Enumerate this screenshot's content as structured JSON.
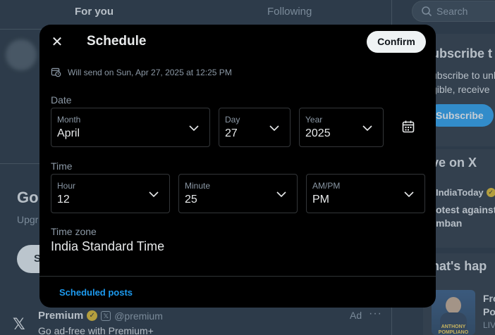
{
  "background": {
    "tabs": {
      "for_you": "For you",
      "following": "Following"
    },
    "search_placeholder": "Search",
    "promo": {
      "heading": "Go",
      "sub": "Upgr",
      "button": "S"
    },
    "ad": {
      "name": "Premium",
      "handle": "@premium",
      "ad_label": "Ad",
      "more": "···",
      "text": "Go ad-free with Premium+"
    },
    "sidebar": {
      "subscribe_heading": "ubscribe t",
      "subscribe_line1": "ubscribe to unl",
      "subscribe_line2": "gible, receive",
      "subscribe_button": "Subscribe",
      "live_heading": "ve on X",
      "live_account": "IndiaToday",
      "live_line1": "otest against",
      "live_line2": "mban",
      "happening_heading": "hat's hap",
      "news_line1": "Fro",
      "news_line2": "Po",
      "news_line3": "LIV",
      "thumb_caption": "ANTHONY POMPLIANO"
    }
  },
  "modal": {
    "title": "Schedule",
    "confirm": "Confirm",
    "will_send": "Will send on Sun, Apr 27, 2025 at 12:25 PM",
    "date_label": "Date",
    "date": {
      "month": {
        "label": "Month",
        "value": "April"
      },
      "day": {
        "label": "Day",
        "value": "27"
      },
      "year": {
        "label": "Year",
        "value": "2025"
      }
    },
    "time_label": "Time",
    "time": {
      "hour": {
        "label": "Hour",
        "value": "12"
      },
      "minute": {
        "label": "Minute",
        "value": "25"
      },
      "ampm": {
        "label": "AM/PM",
        "value": "PM"
      }
    },
    "timezone_label": "Time zone",
    "timezone_value": "India Standard Time",
    "scheduled_posts": "Scheduled posts"
  },
  "colors": {
    "accent": "#1d9bf0",
    "modal_bg": "#000000",
    "page_bg": "#15202b",
    "verified_gold": "#e2b719"
  }
}
